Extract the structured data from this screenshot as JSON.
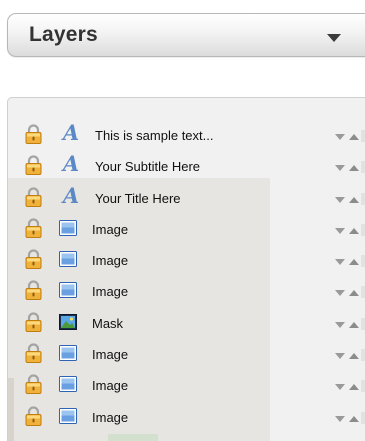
{
  "dropdown": {
    "label": "Layers"
  },
  "colors": {
    "panel_bg": "#f1f1f1",
    "text_icon": "#5b88c6",
    "lock": "#e6a42e"
  },
  "layers": [
    {
      "name": "This is sample text...",
      "kind": "text",
      "icon": "text-layer-icon"
    },
    {
      "name": "Your Subtitle Here",
      "kind": "text",
      "icon": "text-layer-icon"
    },
    {
      "name": "Your Title Here",
      "kind": "text",
      "icon": "text-layer-icon"
    },
    {
      "name": "Image",
      "kind": "image",
      "icon": "image-layer-icon"
    },
    {
      "name": "Image",
      "kind": "image",
      "icon": "image-layer-icon"
    },
    {
      "name": "Image",
      "kind": "image",
      "icon": "image-layer-icon"
    },
    {
      "name": "Mask",
      "kind": "mask",
      "icon": "mask-layer-icon"
    },
    {
      "name": "Image",
      "kind": "image",
      "icon": "image-layer-icon"
    },
    {
      "name": "Image",
      "kind": "image",
      "icon": "image-layer-icon"
    },
    {
      "name": "Image",
      "kind": "image",
      "icon": "image-layer-icon"
    }
  ]
}
